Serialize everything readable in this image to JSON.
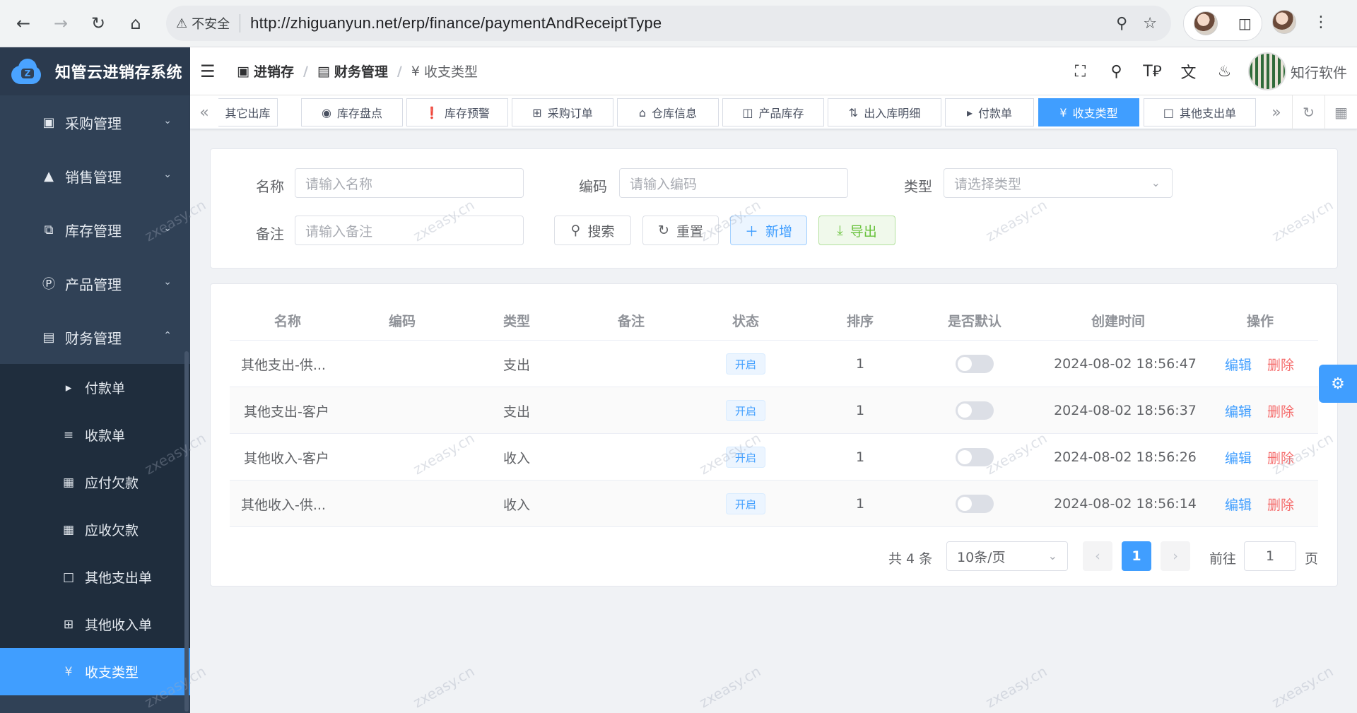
{
  "browser": {
    "security_label": "不安全",
    "url": "http://zhiguanyun.net/erp/finance/paymentAndReceiptType"
  },
  "app": {
    "title": "知管云进销存系统",
    "user_name": "知行软件"
  },
  "sidebar": {
    "groups": [
      {
        "label": "采购管理",
        "icon": "purchase-icon",
        "expanded": false
      },
      {
        "label": "销售管理",
        "icon": "sales-icon",
        "expanded": false
      },
      {
        "label": "库存管理",
        "icon": "inventory-icon",
        "expanded": false
      },
      {
        "label": "产品管理",
        "icon": "product-icon",
        "expanded": false
      },
      {
        "label": "财务管理",
        "icon": "finance-icon",
        "expanded": true
      }
    ],
    "finance_items": [
      {
        "label": "付款单",
        "icon": "caret-right-icon"
      },
      {
        "label": "收款单",
        "icon": "list-icon"
      },
      {
        "label": "应付欠款",
        "icon": "calendar-icon"
      },
      {
        "label": "应收欠款",
        "icon": "calendar-icon"
      },
      {
        "label": "其他支出单",
        "icon": "folder-icon"
      },
      {
        "label": "其他收入单",
        "icon": "folder-add-icon"
      },
      {
        "label": "收支类型",
        "icon": "yen-icon",
        "active": true
      }
    ]
  },
  "breadcrumb": [
    {
      "label": "进销存",
      "icon": "store-icon"
    },
    {
      "label": "财务管理",
      "icon": "finance-icon"
    },
    {
      "label": "收支类型",
      "icon": "yen-icon"
    }
  ],
  "tags": [
    {
      "label": "其它出库",
      "icon": ""
    },
    {
      "label": "库存盘点",
      "icon": "check-circle-icon"
    },
    {
      "label": "库存预警",
      "icon": "warning-circle-icon"
    },
    {
      "label": "采购订单",
      "icon": "grid-icon"
    },
    {
      "label": "仓库信息",
      "icon": "home-icon"
    },
    {
      "label": "产品库存",
      "icon": "trash-box-icon"
    },
    {
      "label": "出入库明细",
      "icon": "swap-icon"
    },
    {
      "label": "付款单",
      "icon": "caret-right-icon"
    },
    {
      "label": "收支类型",
      "icon": "yen-icon",
      "active": true
    },
    {
      "label": "其他支出单",
      "icon": "folder-icon"
    }
  ],
  "search": {
    "name_label": "名称",
    "name_placeholder": "请输入名称",
    "code_label": "编码",
    "code_placeholder": "请输入编码",
    "type_label": "类型",
    "type_placeholder": "请选择类型",
    "remark_label": "备注",
    "remark_placeholder": "请输入备注",
    "search_btn": "搜索",
    "reset_btn": "重置",
    "add_btn": "新增",
    "export_btn": "导出"
  },
  "table": {
    "columns": [
      "名称",
      "编码",
      "类型",
      "备注",
      "状态",
      "排序",
      "是否默认",
      "创建时间",
      "操作"
    ],
    "rows": [
      {
        "name": "其他支出-供...",
        "code": "",
        "type": "支出",
        "remark": "",
        "status": "开启",
        "sort": "1",
        "is_default": false,
        "created": "2024-08-02 18:56:47"
      },
      {
        "name": "其他支出-客户",
        "code": "",
        "type": "支出",
        "remark": "",
        "status": "开启",
        "sort": "1",
        "is_default": false,
        "created": "2024-08-02 18:56:37"
      },
      {
        "name": "其他收入-客户",
        "code": "",
        "type": "收入",
        "remark": "",
        "status": "开启",
        "sort": "1",
        "is_default": false,
        "created": "2024-08-02 18:56:26"
      },
      {
        "name": "其他收入-供...",
        "code": "",
        "type": "收入",
        "remark": "",
        "status": "开启",
        "sort": "1",
        "is_default": false,
        "created": "2024-08-02 18:56:14"
      }
    ],
    "edit_label": "编辑",
    "delete_label": "删除"
  },
  "pagination": {
    "total_text": "共 4 条",
    "page_size": "10条/页",
    "current_page": "1",
    "goto_label": "前往",
    "goto_value": "1",
    "page_suffix": "页"
  },
  "watermark": "zxeasy.cn",
  "colors": {
    "sidebar_bg": "#304156",
    "primary": "#409eff",
    "danger": "#f56c6c",
    "success": "#67c23a"
  }
}
